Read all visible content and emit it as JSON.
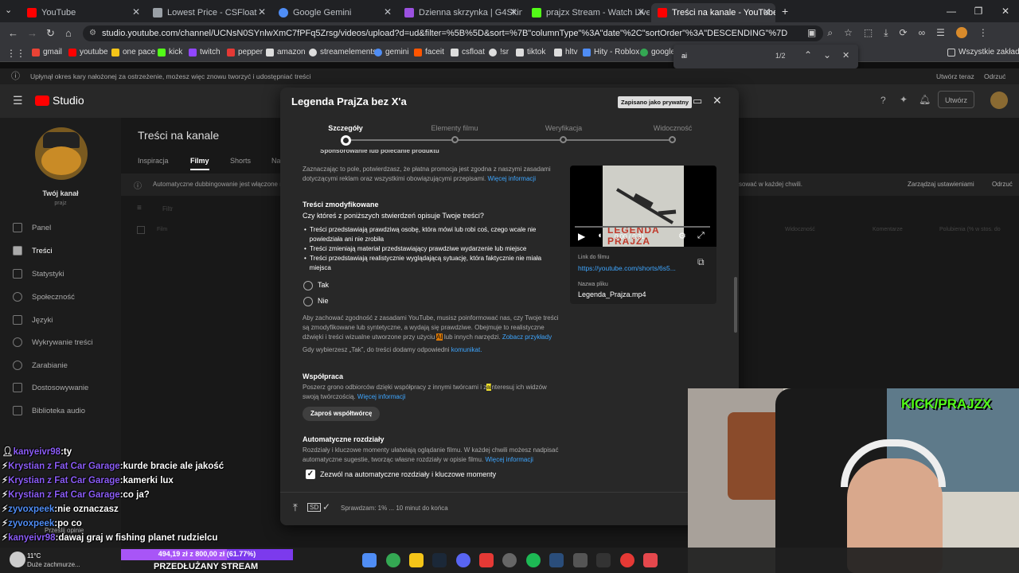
{
  "browser": {
    "tabs": [
      {
        "title": "YouTube",
        "color": "#ff0000"
      },
      {
        "title": "Lowest Price - CSFloat",
        "color": "#9aa0a6"
      },
      {
        "title": "Google Gemini",
        "color": "#4f8df5"
      },
      {
        "title": "Dzienna skrzynka | G4Skins - O...",
        "color": "#9b51e0"
      },
      {
        "title": "prajzx Stream - Watch Live on K...",
        "color": "#53fc18"
      },
      {
        "title": "Treści na kanale - YouTube Studi...",
        "color": "#ff0000"
      }
    ],
    "url": "studio.youtube.com/channel/UCNsN0SYnlwXmC7fPFq5Zrsg/videos/upload?d=ud&filter=%5B%5D&sort=%7B\"columnType\"%3A\"date\"%2C\"sortOrder\"%3A\"DESCENDING\"%7D",
    "bookmarks": [
      {
        "label": "gmail",
        "color": "#ea4335"
      },
      {
        "label": "youtube",
        "color": "#ff0000"
      },
      {
        "label": "one pace",
        "color": "#f5c518"
      },
      {
        "label": "kick",
        "color": "#53fc18"
      },
      {
        "label": "twitch",
        "color": "#9146ff"
      },
      {
        "label": "pepper",
        "color": "#e53935"
      },
      {
        "label": "amazon",
        "color": "#dddddd"
      },
      {
        "label": "streamelements",
        "color": "#dddddd"
      },
      {
        "label": "gemini",
        "color": "#4f8df5"
      },
      {
        "label": "faceit",
        "color": "#ff5500"
      },
      {
        "label": "csfloat",
        "color": "#dddddd"
      },
      {
        "label": "!sr",
        "color": "#dddddd"
      },
      {
        "label": "tiktok",
        "color": "#dddddd"
      },
      {
        "label": "hltv",
        "color": "#dddddd"
      },
      {
        "label": "Hity - Roblox",
        "color": "#4f8df5"
      },
      {
        "label": "google",
        "color": "#34a853"
      }
    ],
    "all_bookmarks": "Wszystkie zakładki",
    "find": {
      "query": "ai",
      "count": "1/2"
    }
  },
  "studio": {
    "notice": "Upłynął okres kary nałożonej za ostrzeżenie, możesz więc znowu tworzyć i udostępniać treści",
    "notice_create": "Utwórz teraz",
    "notice_dismiss": "Odrzuć",
    "logo": "Studio",
    "create_label": "Utwórz",
    "page_title": "Treści na kanale",
    "tabs": [
      "Inspiracja",
      "Filmy",
      "Shorts",
      "Na"
    ],
    "channel_label": "Twój kanał",
    "channel_name": "prajz",
    "nav": [
      "Panel",
      "Treści",
      "Statystyki",
      "Społeczność",
      "Języki",
      "Wykrywanie treści",
      "Zarabianie",
      "Dostosowywanie",
      "Biblioteka audio"
    ],
    "dubbing_text": "Automatyczne dubbingowanie jest włączone n",
    "dubbing_right": "sować w każdej chwili.",
    "dubbing_manage": "Zarządzaj ustawieniami",
    "dubbing_dismiss": "Odrzuć",
    "filter_label": "Filtr",
    "col_film": "Film",
    "col_visibility": "Widoczność",
    "col_comments": "Komentarze",
    "col_likes": "Polubienia (% w stos. do"
  },
  "dialog": {
    "title": "Legenda PrajZa bez X'a",
    "saved_badge": "Zapisano jako prywatny",
    "steps": [
      "Szczegóły",
      "Elementy filmu",
      "Weryfikacja",
      "Widoczność"
    ],
    "cut_text": "Sponsorowanie lub polecanie produktu",
    "paid_text_1": "Zaznaczając to pole, potwierdzasz, że płatna promocja jest zgodna z naszymi zasadami",
    "paid_text_2": "dotyczącymi reklam oraz wszystkimi obowiązującymi przepisami.",
    "more_info": "Więcej informacji",
    "modified_heading": "Treści zmodyfikowane",
    "modified_question": "Czy któreś z poniższych stwierdzeń opisuje Twoje treści?",
    "bullets": [
      [
        "Treści przedstawiają prawdziwą osobę, która mówi lub robi coś, czego wcale nie",
        "powiedziała ani nie zrobiła"
      ],
      [
        "Treści zmieniają materiał przedstawiający prawdziwe wydarzenie lub miejsce"
      ],
      [
        "Treści przedstawiają realistycznie wyglądającą sytuację, która faktycznie nie miała",
        "miejsca"
      ]
    ],
    "yes": "Tak",
    "no": "Nie",
    "disclosure_1": "Aby zachować zgodność z zasadami YouTube, musisz poinformować nas, czy Twoje treści",
    "disclosure_2": "są zmodyfikowane lub syntetyczne, a wydają się prawdziwe. Obejmuje to realistyczne",
    "disclosure_3": "dźwięki i treści wizualne utworzone przy użyciu",
    "disclosure_ai": "AI",
    "disclosure_3b": "lub innych narzędzi.",
    "examples_link": "Zobacz przykłady",
    "tak_note": "Gdy wybierzesz „Tak”, do treści dodamy odpowiedni",
    "tak_link": "komunikat.",
    "collab_heading": "Współpraca",
    "collab_text_1": "Poszerz grono odbiorców dzięki współpracy z innymi twórcami i z",
    "collab_ai": "ai",
    "collab_text_1b": "nteresuj ich widzów",
    "collab_text_2": "swoją twórczością.",
    "collab_button": "Zaproś współtwórcę",
    "chapters_heading": "Automatyczne rozdziały",
    "chapters_text_1": "Rozdziały i kluczowe momenty ułatwiają oglądanie filmu. W każdej chwili możesz nadpisać",
    "chapters_text_2": "automatyczne sugestie, tworząc własne rozdziały w opisie filmu.",
    "chapters_checkbox": "Zezwól na automatyczne rozdziały i kluczowe momenty",
    "video_time": "0:00 / 0:31",
    "thumb_text": "LEGENDA PRAJZA",
    "link_label": "Link do filmu",
    "link_value": "https://youtube.com/shorts/6s5...",
    "file_label": "Nazwa pliku",
    "file_value": "Legenda_Prajza.mp4",
    "status": "Sprawdzam: 1% ... 10 minut do końca"
  },
  "stream": {
    "chat": [
      {
        "user": "kanyeivr98",
        "msg": ":ty"
      },
      {
        "user": "Krystian z Fat Car Garage",
        "msg": ":kurde bracie ale jakość"
      },
      {
        "user": "Krystian z Fat Car Garage",
        "msg": ":kamerki lux"
      },
      {
        "user": "Krystian z Fat Car Garage",
        "msg": ":co ja?"
      },
      {
        "user": "zyvoxpeek",
        "msg": ":nie oznaczasz"
      },
      {
        "user": "zyvoxpeek",
        "msg": ":po co"
      },
      {
        "user": "kanyeivr98",
        "msg": ":dawaj graj w fishing planet rudzielcu"
      }
    ],
    "feedback": "Prześlij opinię",
    "goal": "494,19 zł z 800,00 zł (61.77%)",
    "goal_progress": 0.6177,
    "banner": "PRZEDŁUŻANY STREAM",
    "watermark": "KICK/PRAJZX"
  },
  "taskbar": {
    "temp": "11°C",
    "weather": "Duże zachmurze..."
  }
}
